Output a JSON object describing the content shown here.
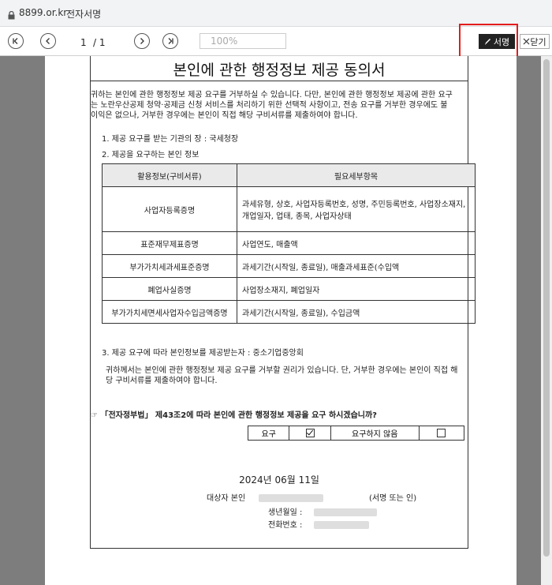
{
  "browser": {
    "url": "8899.or.kr",
    "title": "전자서명"
  },
  "toolbar": {
    "current_page": "1",
    "total_pages": "/ 1",
    "zoom": "100%",
    "sign_label": "서명",
    "close_label": "닫기"
  },
  "document": {
    "title": "본인에 관한 행정정보 제공 동의서",
    "intro": [
      "귀하는 본인에 관한 행정정보 제공 요구를 거부하실 수 있습니다. 다만, 본인에 관한 행정정보 제공에 관한 요구",
      "는 노란우산공제 청약·공제금 신청 서비스를 처리하기 위한 선택적 사항이고, 전송 요구를 거부한 경우에도 불",
      "이익은 없으나, 거부한 경우에는 본인이 직접 해당 구비서류를 제출하여야 합니다."
    ],
    "item1": "1. 제공 요구를 받는 기관의 장 : 국세청장",
    "item2": "2. 제공을 요구하는 본인 정보",
    "table": {
      "headers": [
        "활용정보(구비서류)",
        "필요세부항목"
      ],
      "rows": [
        {
          "doc": "사업자등록증명",
          "detail": "과세유형, 상호, 사업자등록번호, 성명, 주민등록번호, 사업장소재지, 개업일자, 업태, 종목, 사업자상태"
        },
        {
          "doc": "표준재무제표증명",
          "detail": "사업연도, 매출액"
        },
        {
          "doc": "부가가치세과세표준증명",
          "detail": "과세기간(시작일, 종료일), 매출과세표준(수입액"
        },
        {
          "doc": "폐업사실증명",
          "detail": "사업장소재지, 폐업일자"
        },
        {
          "doc": "부가가치세면세사업자수입금액증명",
          "detail": "과세기간(시작일, 종료일), 수입금액"
        }
      ]
    },
    "item3": "3. 제공 요구에 따라 본인정보를 제공받는자 : 중소기업중앙회",
    "item3_desc": [
      "귀하께서는 본인에 관한 행정정보 제공 요구를 거부할 권리가 있습니다. 단, 거부한 경우에는 본인이 직접 해",
      "당 구비서류를 제출하여야 합니다."
    ],
    "question": "☞ 「전자정부법」 제43조2에 따라 본인에 관한 행정정보 제공을 요구 하시겠습니까?",
    "consent": {
      "yes_label": "요구",
      "no_label": "요구하지 않음",
      "yes_checked": true,
      "no_checked": false
    },
    "date": "2024년 06월 11일",
    "signer_label": "대상자 본인",
    "sign_note": "(서명 또는 인)",
    "birth_label": "생년월일 :",
    "phone_label": "전화번호 :"
  }
}
